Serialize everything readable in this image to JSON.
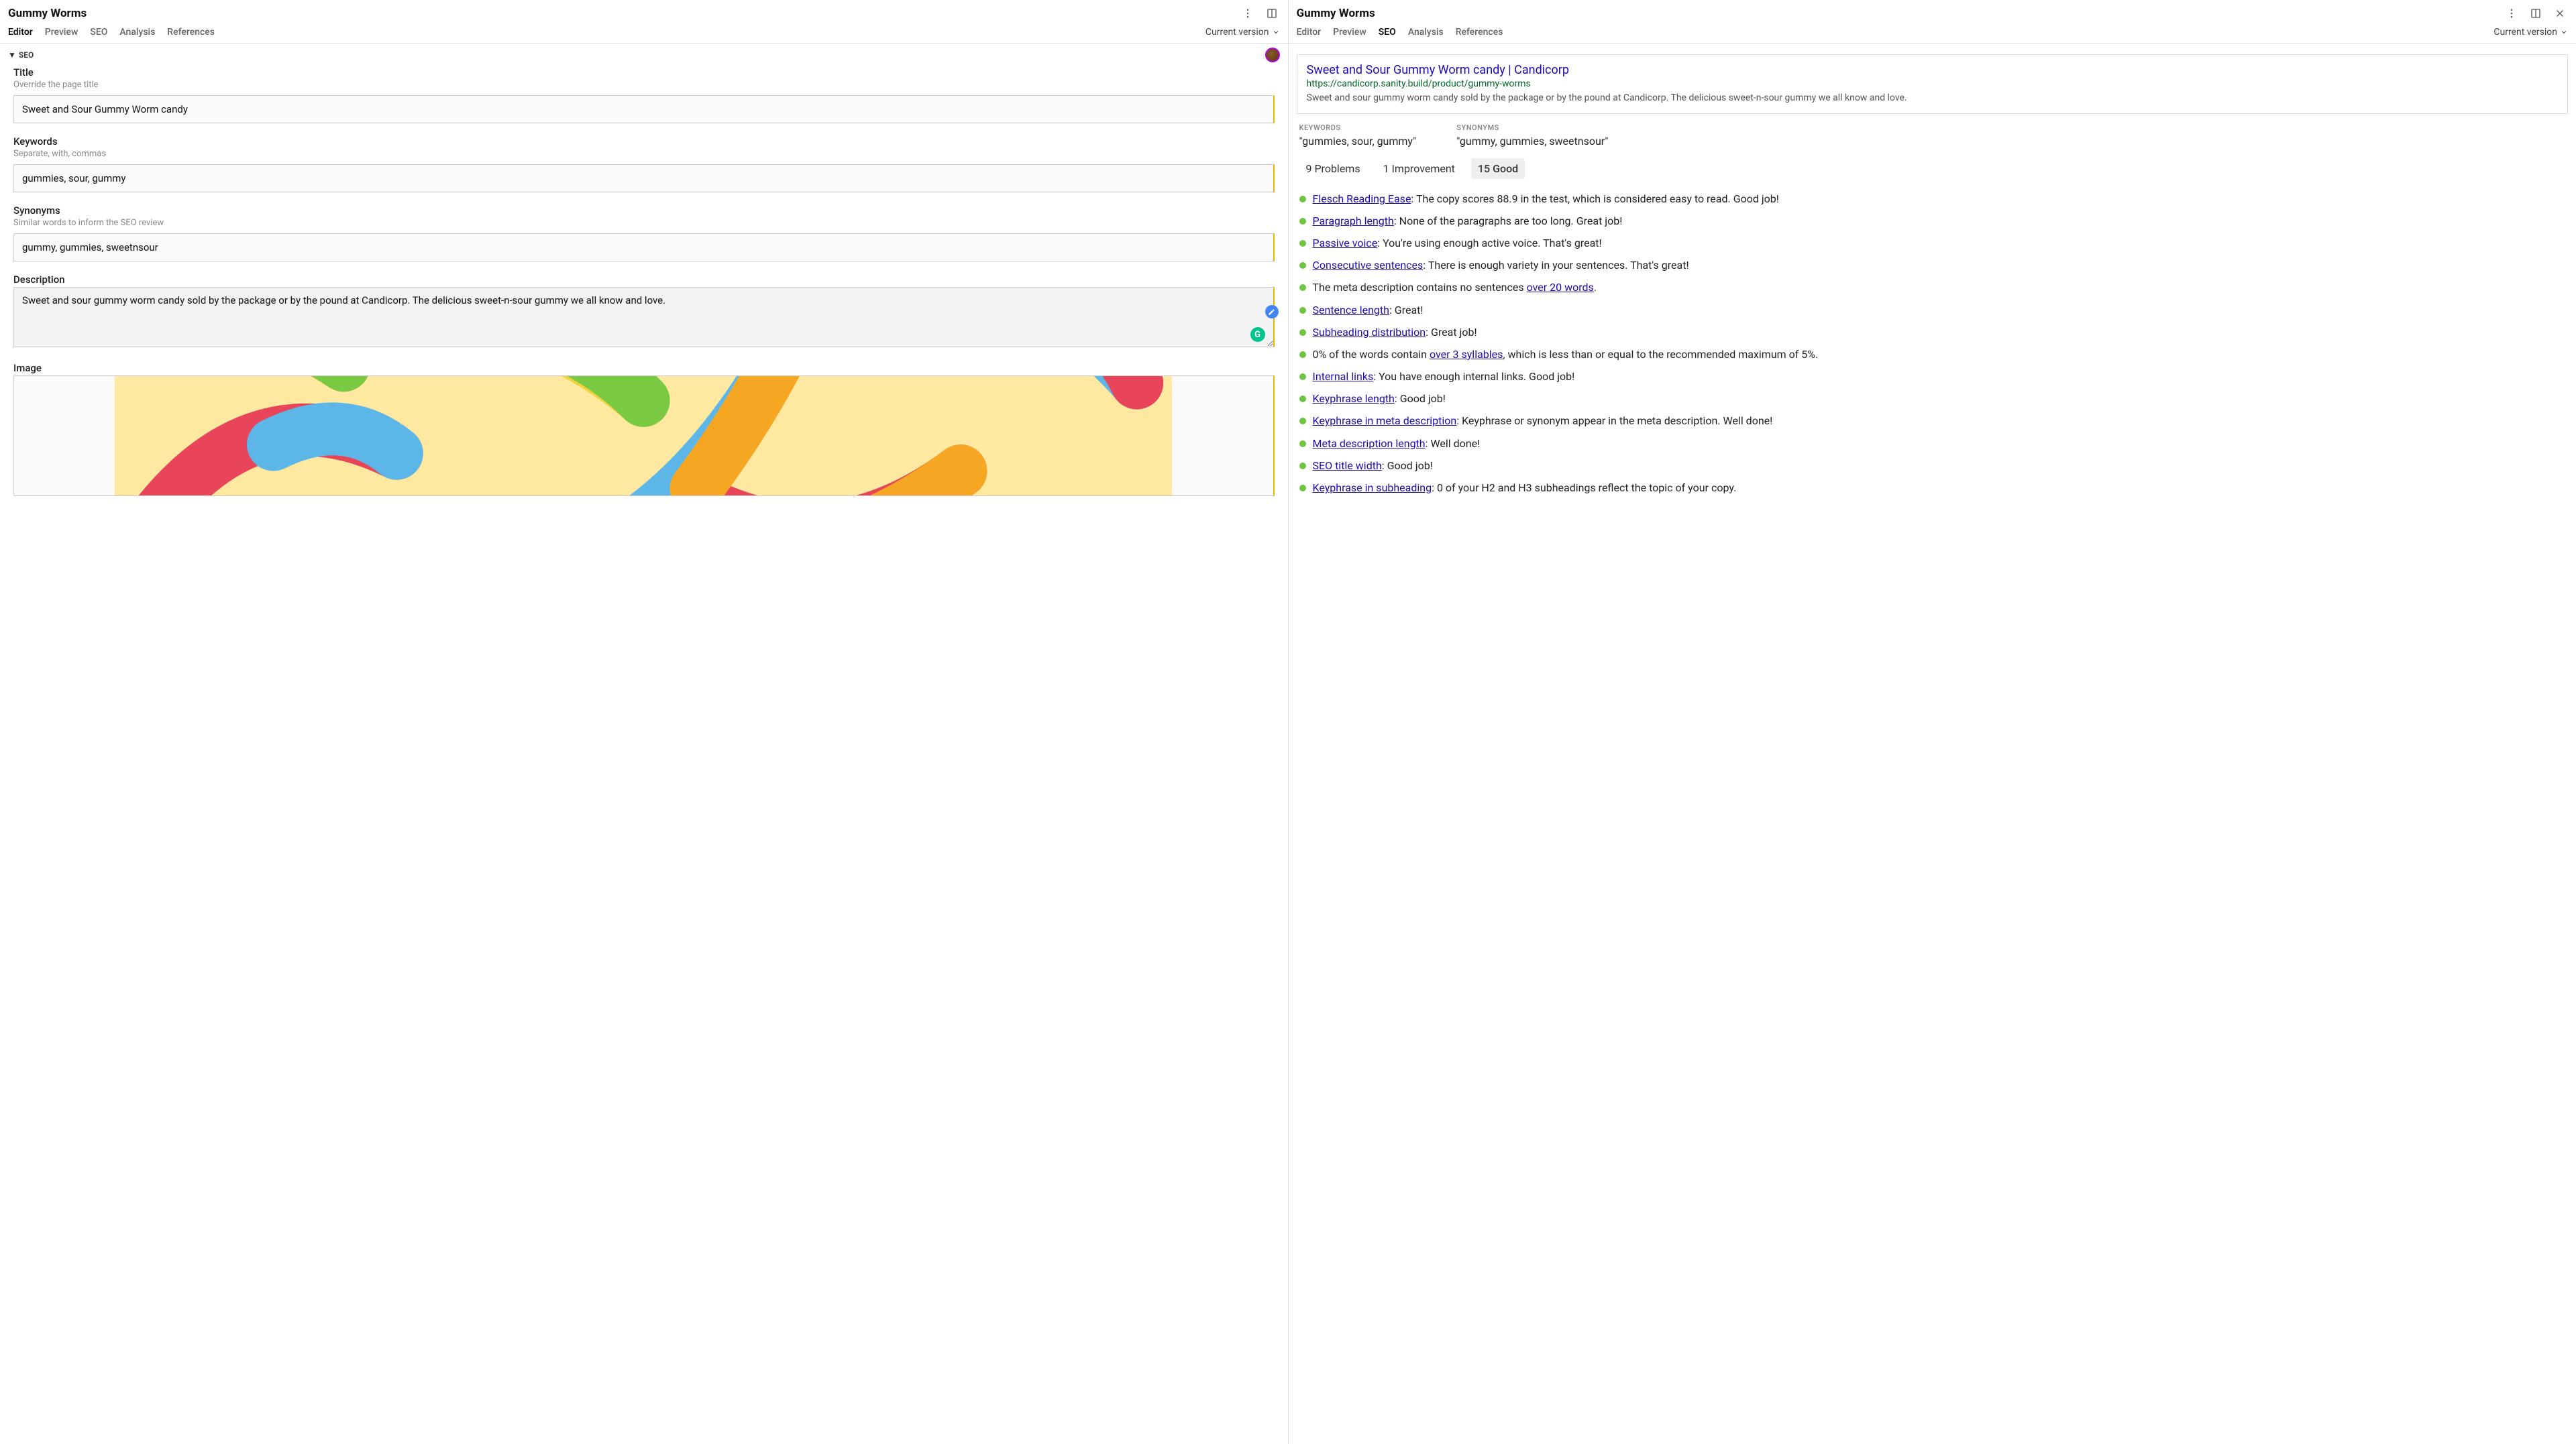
{
  "left": {
    "title": "Gummy Worms",
    "tabs": [
      "Editor",
      "Preview",
      "SEO",
      "Analysis",
      "References"
    ],
    "activeTab": 0,
    "version": "Current version",
    "section": "SEO",
    "fields": {
      "title": {
        "label": "Title",
        "hint": "Override the page title",
        "value": "Sweet and Sour Gummy Worm candy"
      },
      "keywords": {
        "label": "Keywords",
        "hint": "Separate, with, commas",
        "value": "gummies, sour, gummy"
      },
      "synonyms": {
        "label": "Synonyms",
        "hint": "Similar words to inform the SEO review",
        "value": "gummy, gummies, sweetnsour"
      },
      "description": {
        "label": "Description",
        "value": "Sweet and sour gummy worm candy sold by the package or by the pound at Candicorp. The delicious sweet-n-sour gummy we all know and love."
      },
      "image": {
        "label": "Image"
      }
    }
  },
  "right": {
    "title": "Gummy Worms",
    "tabs": [
      "Editor",
      "Preview",
      "SEO",
      "Analysis",
      "References"
    ],
    "activeTab": 2,
    "version": "Current version",
    "serp": {
      "title": "Sweet and Sour Gummy Worm candy | Candicorp",
      "url": "https://candicorp.sanity.build/product/gummy-worms",
      "desc": "Sweet and sour gummy worm candy sold by the package or by the pound at Candicorp. The delicious sweet-n-sour gummy we all know and love."
    },
    "keywordsLabel": "KEYWORDS",
    "keywordsValue": "\"gummies, sour, gummy\"",
    "synonymsLabel": "SYNONYMS",
    "synonymsValue": "\"gummy, gummies, sweetnsour\"",
    "filters": [
      "9 Problems",
      "1 Improvement",
      "15 Good"
    ],
    "activeFilter": 2,
    "results": [
      {
        "link": "Flesch Reading Ease",
        "rest": ": The copy scores 88.9 in the test, which is considered easy to read. Good job!"
      },
      {
        "link": "Paragraph length",
        "rest": ": None of the paragraphs are too long. Great job!"
      },
      {
        "link": "Passive voice",
        "rest": ": You're using enough active voice. That's great!"
      },
      {
        "link": "Consecutive sentences",
        "rest": ": There is enough variety in your sentences. That's great!"
      },
      {
        "pre": "The meta description contains no sentences ",
        "link": "over 20 words",
        "rest": "."
      },
      {
        "link": "Sentence length",
        "rest": ": Great!"
      },
      {
        "link": "Subheading distribution",
        "rest": ": Great job!"
      },
      {
        "pre": "0% of the words contain ",
        "link": "over 3 syllables",
        "rest": ", which is less than or equal to the recommended maximum of 5%."
      },
      {
        "link": "Internal links",
        "rest": ": You have enough internal links. Good job!"
      },
      {
        "link": "Keyphrase length",
        "rest": ": Good job!"
      },
      {
        "link": "Keyphrase in meta description",
        "rest": ": Keyphrase or synonym appear in the meta description. Well done!"
      },
      {
        "link": "Meta description length",
        "rest": ": Well done!"
      },
      {
        "link": "SEO title width",
        "rest": ": Good job!"
      },
      {
        "link": "Keyphrase in subheading",
        "rest": ": 0 of your H2 and H3 subheadings reflect the topic of your copy."
      }
    ]
  }
}
